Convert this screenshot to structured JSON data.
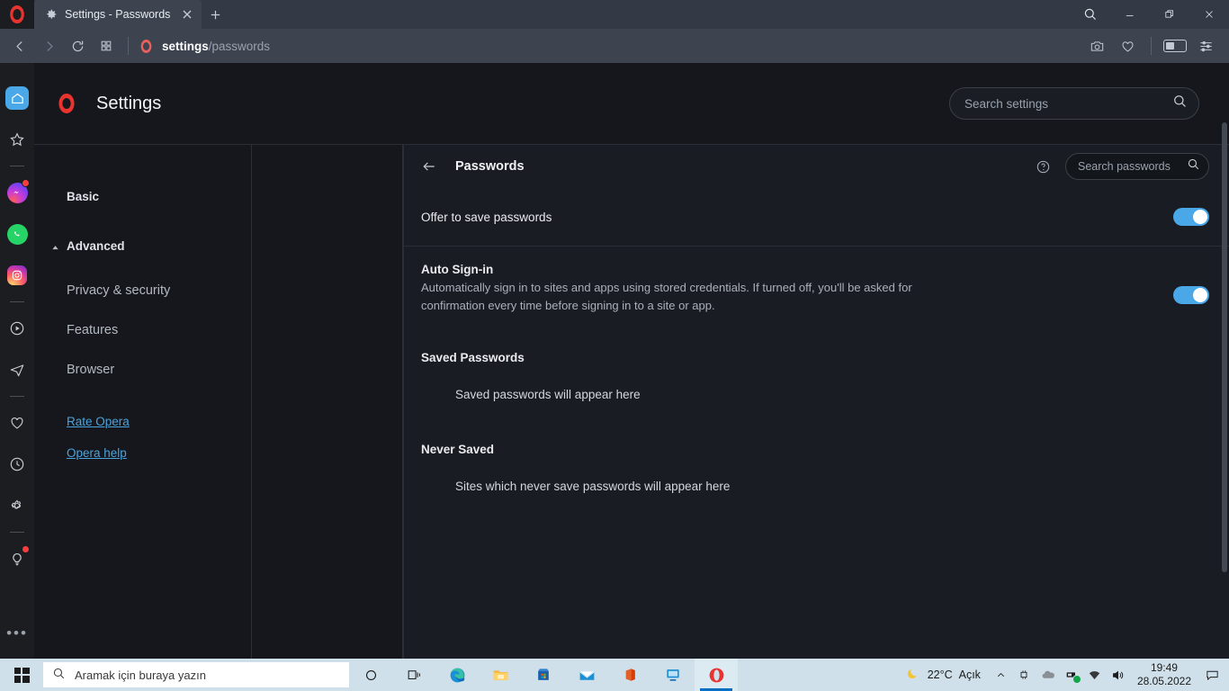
{
  "window": {
    "tab": {
      "title": "Settings - Passwords",
      "favicon": "gear-icon",
      "close": "✕"
    },
    "newtab_label": "+",
    "controls": {
      "search": "search-icon",
      "minimize": "—",
      "restore": "restore-icon",
      "close": "✕"
    }
  },
  "toolbar": {
    "back": "back-arrow-icon",
    "forward": "forward-arrow-icon",
    "reload": "reload-icon",
    "tab_overview": "tab-grid-icon",
    "address_bold": "settings",
    "address_rest": "/passwords",
    "right_icons": [
      "snapshot-camera-icon",
      "heart-favorites-icon",
      "battery-saver-icon",
      "easy-setup-icon"
    ]
  },
  "sidebar": {
    "items": [
      {
        "name": "home",
        "icon": "home-icon",
        "active": true,
        "badge": false
      },
      {
        "name": "favorites",
        "icon": "star-icon",
        "active": false,
        "badge": false
      },
      {
        "name": "messenger",
        "icon": "messenger-icon",
        "active": false,
        "badge": true
      },
      {
        "name": "whatsapp",
        "icon": "whatsapp-icon",
        "active": false,
        "badge": false
      },
      {
        "name": "instagram",
        "icon": "instagram-icon",
        "active": false,
        "badge": false
      },
      {
        "name": "player",
        "icon": "player-icon",
        "active": false,
        "badge": false
      },
      {
        "name": "telegram",
        "icon": "telegram-icon",
        "active": false,
        "badge": false
      },
      {
        "name": "pinboards",
        "icon": "heart-icon",
        "active": false,
        "badge": false
      },
      {
        "name": "history",
        "icon": "clock-icon",
        "active": false,
        "badge": false
      },
      {
        "name": "settings",
        "icon": "gear-icon",
        "active": false,
        "badge": false
      },
      {
        "name": "tips",
        "icon": "lightbulb-icon",
        "active": false,
        "badge": true
      }
    ],
    "more": "•••"
  },
  "settings": {
    "title": "Settings",
    "search": {
      "placeholder": "Search settings",
      "value": ""
    },
    "nav": {
      "basic": "Basic",
      "advanced": "Advanced",
      "sub": [
        "Privacy & security",
        "Features",
        "Browser"
      ],
      "links": [
        "Rate Opera",
        "Opera help"
      ]
    }
  },
  "passwords_panel": {
    "title": "Passwords",
    "back": "back-arrow-icon",
    "help": "help-circle-icon",
    "search": {
      "placeholder": "Search passwords",
      "value": ""
    },
    "rows": [
      {
        "label": "Offer to save passwords",
        "desc": "",
        "toggle_on": true
      },
      {
        "label": "Auto Sign-in",
        "desc": "Automatically sign in to sites and apps using stored credentials. If turned off, you'll be asked for confirmation every time before signing in to a site or app.",
        "toggle_on": true
      }
    ],
    "groups": [
      {
        "title": "Saved Passwords",
        "empty": "Saved passwords will appear here"
      },
      {
        "title": "Never Saved",
        "empty": "Sites which never save passwords will appear here"
      }
    ]
  },
  "taskbar": {
    "start": "windows-logo-icon",
    "search_placeholder": "Aramak için buraya yazın",
    "apps": [
      {
        "name": "cortana",
        "icon": "cortana-circle-icon",
        "active": false
      },
      {
        "name": "task-view",
        "icon": "task-view-icon",
        "active": false
      },
      {
        "name": "edge",
        "icon": "edge-icon",
        "active": false
      },
      {
        "name": "file-explorer",
        "icon": "folder-icon",
        "active": false
      },
      {
        "name": "microsoft-store",
        "icon": "store-icon",
        "active": false
      },
      {
        "name": "mail",
        "icon": "mail-icon",
        "active": false
      },
      {
        "name": "office",
        "icon": "office-icon",
        "active": false
      },
      {
        "name": "remote-desktop",
        "icon": "monitor-icon",
        "active": false
      },
      {
        "name": "opera",
        "icon": "opera-icon",
        "active": true
      }
    ],
    "weather": {
      "icon": "moon-icon",
      "temp": "22°C",
      "condition": "Açık"
    },
    "tray_icons": [
      "chevron-up-icon",
      "screen-snip-icon",
      "onedrive-cloud-icon",
      "usb-device-icon",
      "wifi-icon",
      "volume-icon"
    ],
    "clock": {
      "time": "19:49",
      "date": "28.05.2022"
    },
    "action_center": "notification-icon"
  },
  "colors": {
    "accent_blue": "#4aa8e8",
    "opera_red": "#e8332f",
    "link_blue": "#4aa3dd",
    "panel_bg": "#191c22",
    "page_bg": "#15171c",
    "toolbar_bg": "#3d4450",
    "taskbar_bg": "#cfe0ea"
  }
}
